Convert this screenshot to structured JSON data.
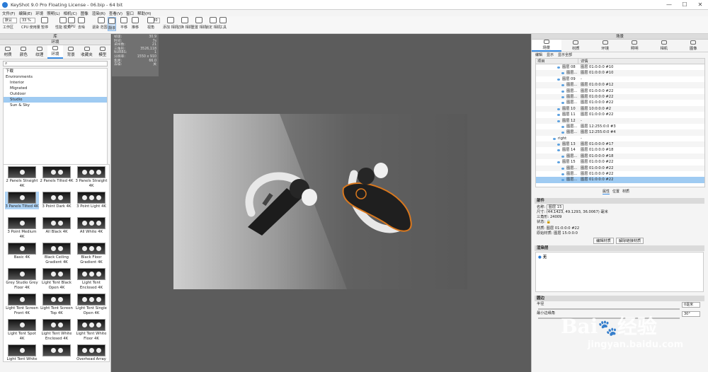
{
  "window": {
    "title": "KeyShot 9.0 Pro Floating License - 06.bip - 64 bit",
    "controls": [
      "—",
      "☐",
      "✕"
    ]
  },
  "menu": [
    "文件(F)",
    "编辑(E)",
    "环境",
    "照明(L)",
    "相机(C)",
    "图像",
    "渲染(R)",
    "查看(V)",
    "窗口",
    "帮助(H)"
  ],
  "toolbar": {
    "preset": "默认",
    "zoom": "33 %",
    "cpu_value": "100",
    "items": [
      {
        "name": "workspace",
        "label": "工作区"
      },
      {
        "name": "cpu-usage",
        "label": "CPU 使用量"
      },
      {
        "name": "pause",
        "label": "暂停"
      },
      {
        "name": "performance-mode",
        "label": "性能 模式"
      },
      {
        "name": "gpu",
        "label": "GPU"
      },
      {
        "name": "denoise",
        "label": "去噪"
      },
      {
        "name": "region-render",
        "label": "退染 范围图"
      },
      {
        "name": "tumble",
        "label": "翻滚"
      },
      {
        "name": "pan",
        "label": "平移"
      },
      {
        "name": "dolly",
        "label": "推移"
      },
      {
        "name": "fov",
        "label": "视角"
      },
      {
        "name": "add-camera",
        "label": "添加 相机"
      },
      {
        "name": "switch-camera",
        "label": "切换 相机"
      },
      {
        "name": "reset-camera",
        "label": "重置 相机"
      },
      {
        "name": "lock-camera",
        "label": "锁定 相机"
      },
      {
        "name": "tools",
        "label": "工具"
      }
    ]
  },
  "library": {
    "title": "库",
    "tabs": [
      "材质",
      "颜色",
      "纹理",
      "环境",
      "背景",
      "收藏夹",
      "模型"
    ],
    "env_header": "环境",
    "tree": [
      "下载",
      "Environments",
      "Interior",
      "Migrated",
      "Outdoor",
      "Studio",
      "Sun & Sky"
    ],
    "thumbs": [
      "2 Panels Straight 4K",
      "2 Panels Tilted 4K",
      "3 Panels Straight 4K",
      "3 Panels Tilted 4K",
      "3 Point Dark 4K",
      "3 Point Light 4K",
      "3 Point Medium 4K",
      "All Black 4K",
      "All White 4K",
      "Basic 4K",
      "Black Ceiling Gradient 4K",
      "Black Floor Gradient 4K",
      "Grey Studio Grey Floor 4K",
      "Light Tent Black Open 4K",
      "Light Tent Enclosed 4K",
      "Light Tent Screen Front 4K",
      "Light Tent Screen Top 4K",
      "Light Tent Single Open 4K",
      "Light Tent Spot 4K",
      "Light Tent White Enclosed 4K",
      "Light Tent White Floor 4K",
      "Light Tent White",
      "",
      "Overhead Array"
    ]
  },
  "hud": [
    [
      "帧速:",
      "30.9"
    ],
    [
      "时间:",
      "7s"
    ],
    [
      "采样数:",
      "21"
    ],
    [
      "三角形:",
      "3526,118"
    ],
    [
      "NURBS:",
      "1"
    ],
    [
      "分辨率:",
      "1550 x 910"
    ],
    [
      "焦距:",
      "66.0"
    ],
    [
      "去噪:",
      "关"
    ]
  ],
  "scene": {
    "title": "场景",
    "tabs": [
      "场景",
      "材质",
      "环境",
      "照明",
      "相机",
      "图像"
    ],
    "toolbar": [
      "编辑",
      "显示",
      "显示全部"
    ],
    "cols": [
      "项目",
      "详情"
    ],
    "rows": [
      {
        "indent": 10,
        "name": "图层 08",
        "detail": "图层 01:0:0:0 #10"
      },
      {
        "indent": 16,
        "name": "图层...",
        "detail": "图层 01:0:0:0 #10"
      },
      {
        "indent": 10,
        "name": "图层 09",
        "detail": "-"
      },
      {
        "indent": 16,
        "name": "图层...",
        "detail": "图层 01:0:0:0 #12"
      },
      {
        "indent": 16,
        "name": "图层...",
        "detail": "图层 01:0:0:0 #22"
      },
      {
        "indent": 16,
        "name": "图层...",
        "detail": "图层 01:0:0:0 #22"
      },
      {
        "indent": 16,
        "name": "图层...",
        "detail": "图层 01:0:0:0 #22"
      },
      {
        "indent": 10,
        "name": "图层 10",
        "detail": "图层 10:0:0:0 #2"
      },
      {
        "indent": 10,
        "name": "图层 11",
        "detail": "图层 01:0:0:0 #22"
      },
      {
        "indent": 10,
        "name": "图层 12",
        "detail": "-"
      },
      {
        "indent": 16,
        "name": "图层...",
        "detail": "图层 12:255:0:0 #3"
      },
      {
        "indent": 16,
        "name": "图层...",
        "detail": "图层 12:255:0:0 #4"
      },
      {
        "indent": 4,
        "name": "right",
        "detail": "-"
      },
      {
        "indent": 10,
        "name": "图层 13",
        "detail": "图层 01:0:0:0 #17"
      },
      {
        "indent": 10,
        "name": "图层 14",
        "detail": "图层 01:0:0:0 #18"
      },
      {
        "indent": 16,
        "name": "图层...",
        "detail": "图层 01:0:0:0 #18"
      },
      {
        "indent": 10,
        "name": "图层 15",
        "detail": "图层 01:0:0:0 #22"
      },
      {
        "indent": 16,
        "name": "图层...",
        "detail": "图层 01:0:0:0 #22"
      },
      {
        "indent": 16,
        "name": "图层...",
        "detail": "图层 01:0:0:0 #22"
      },
      {
        "indent": 16,
        "name": "图层...",
        "detail": "图层 01:0:0:0 #22",
        "selected": true
      }
    ],
    "subtabs": [
      "属性",
      "位置",
      "材质"
    ]
  },
  "parts": {
    "header": "部件",
    "name_label": "名称:",
    "name_value": "图层 15",
    "size_label": "尺寸:",
    "size_value": "(44.1423, 49.1293, 36.0067) 毫米",
    "tri_label": "三角形:",
    "tri_value": "24009",
    "state_label": "状态:",
    "state_value": "🔒",
    "mat_label": "材质:",
    "mat_value": "图层 01:0:0:0 #22",
    "root_label": "原始材质:",
    "root_value": "图层 15:0:0:0",
    "btn_edit": "编辑材质",
    "btn_unlink": "解除链接材质"
  },
  "render_layer": {
    "header": "渲染层",
    "value": "无"
  },
  "rounding": {
    "header": "圆边",
    "radius_label": "半径",
    "radius_value": "0毫米",
    "angle_label": "最小边缘角",
    "angle_value": "30°"
  },
  "watermark": {
    "brand": "Bai",
    "suffix": "经验",
    "url": "jingyan.baidu.com"
  }
}
